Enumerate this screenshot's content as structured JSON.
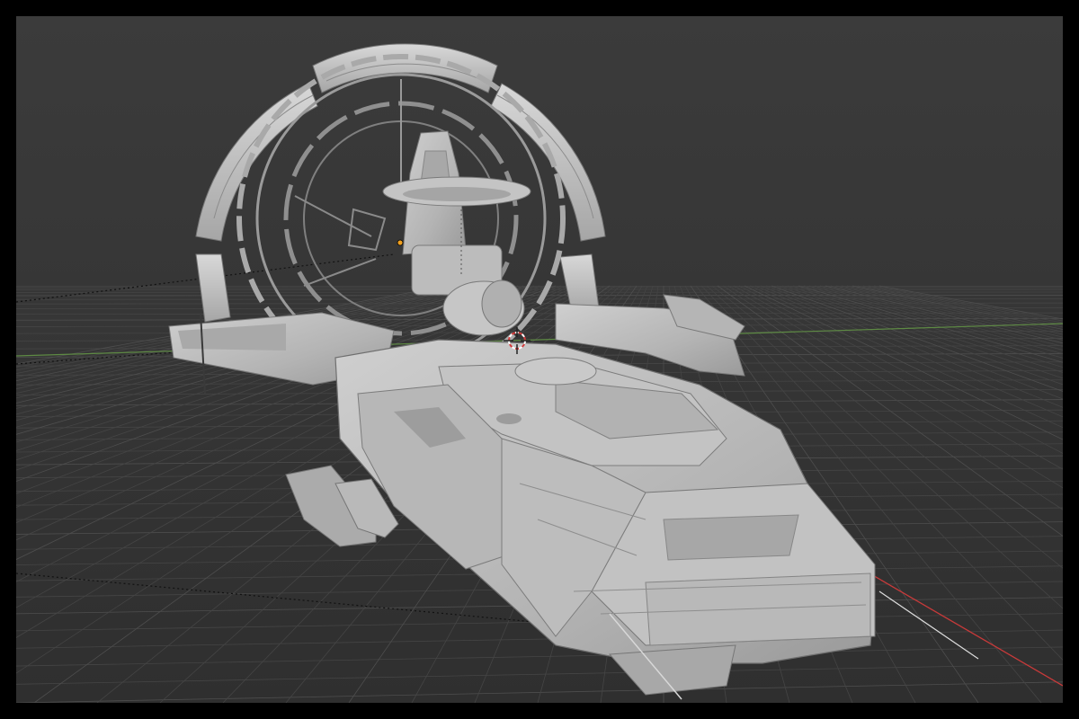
{
  "viewport": {
    "mode": "3d-viewport",
    "shading": "solid",
    "background_color": "#3a3a3a",
    "grid_color": "#454545",
    "grid_major_color": "#4e4e4e",
    "x_axis_color": "#c83a3a",
    "y_axis_color": "#6a9a4a",
    "model_color": "#b8b8b8",
    "model_shadow_color": "#8a8a8a",
    "model_highlight_color": "#d6d6d6",
    "cursor_color": "#d23c3c",
    "origin_color": "#f0a020",
    "icons": [
      "3d-cursor-icon",
      "object-origin-icon"
    ]
  }
}
